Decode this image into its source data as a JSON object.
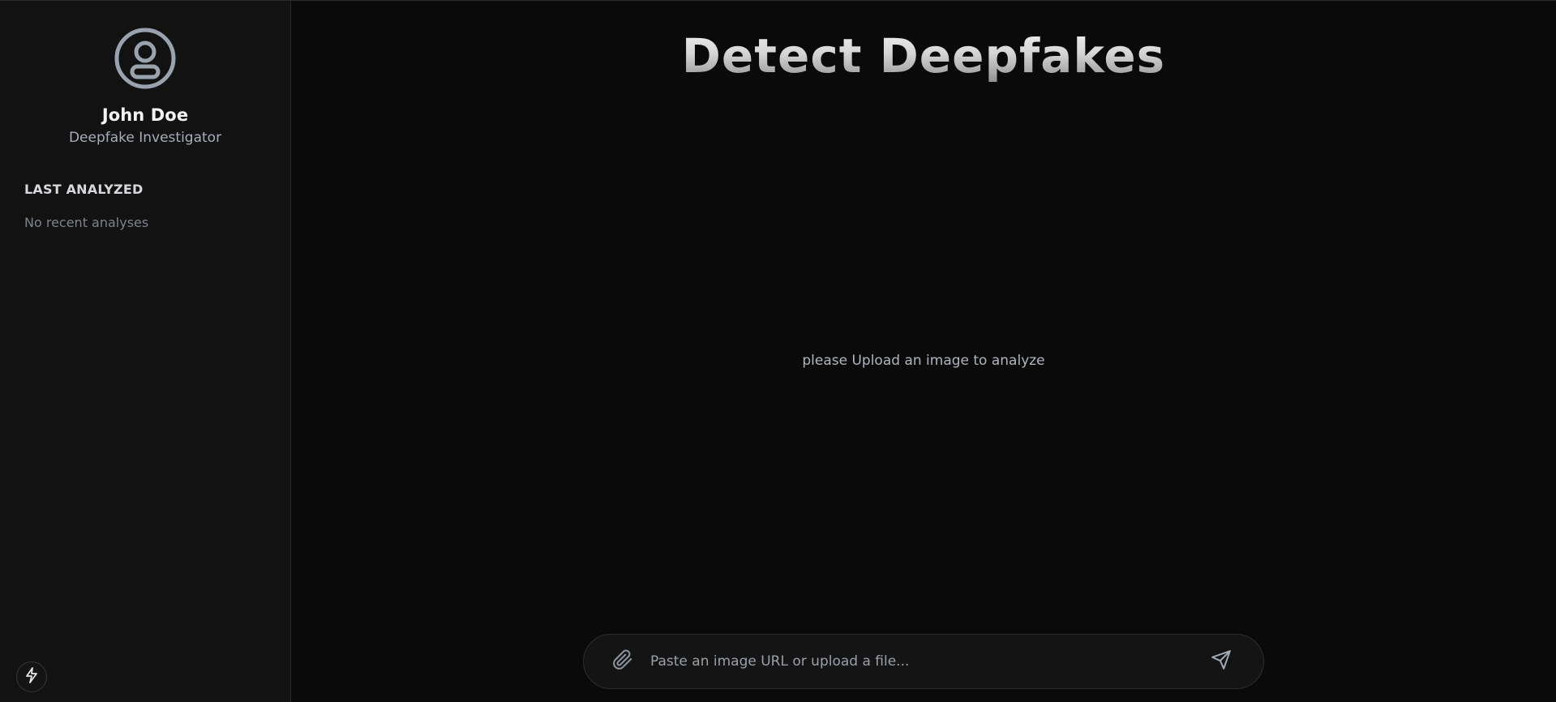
{
  "app": {
    "title": "Detect Deepfakes"
  },
  "sidebar": {
    "user": {
      "name": "John Doe",
      "role": "Deepfake Investigator",
      "avatar_icon": "user-circle-icon"
    },
    "history": {
      "title": "LAST ANALYZED",
      "empty_text": "No recent analyses"
    },
    "footer_button_icon": "lightning-bolt-icon"
  },
  "main": {
    "empty_message": "please Upload an image to analyze"
  },
  "input_bar": {
    "placeholder": "Paste an image URL or upload a file...",
    "value": "",
    "attach_icon": "paperclip-icon",
    "send_icon": "send-icon"
  },
  "colors": {
    "background": "#0a0a0a",
    "sidebar_background": "#121212",
    "accent_icon": "#9aa2ad"
  }
}
